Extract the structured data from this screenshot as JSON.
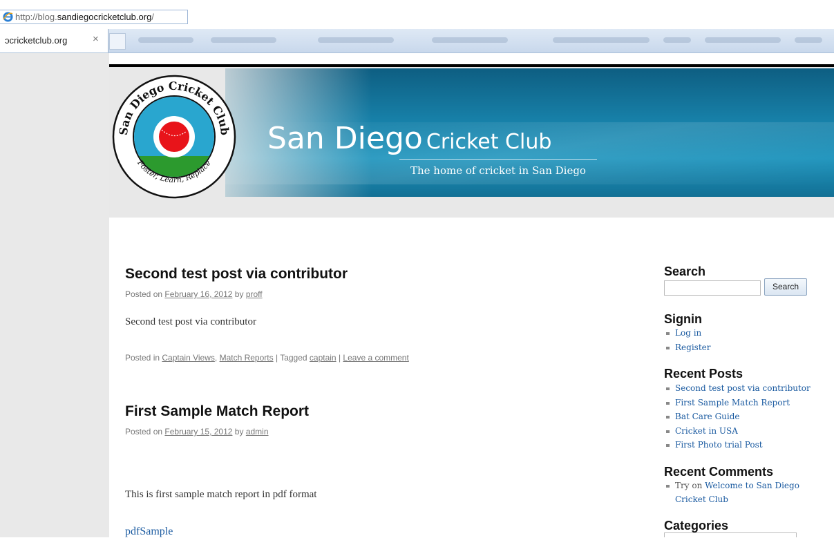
{
  "browser": {
    "url_prefix": "http://blog.",
    "url_domain": "sandiegocricketclub.org",
    "url_suffix": "/",
    "tab_title": "ɔcricketclub.org",
    "tab_close": "×"
  },
  "header": {
    "site_title_big": "San Diego",
    "site_title_small": "Cricket Club",
    "tagline": "The home of cricket in San Diego",
    "logo_ring_top": "San Diego Cricket Club",
    "logo_ring_bottom": "Foster, Learn, Replace"
  },
  "posts": [
    {
      "title": "Second test post via contributor",
      "meta_prefix": "Posted on",
      "date": "February 16, 2012",
      "by": "by",
      "author": "proff",
      "body": "Second test post via contributor",
      "posted_in": "Posted in",
      "category1": "Captain Views",
      "sep": ",",
      "category2": "Match Reports",
      "tagged": "| Tagged",
      "tag": "captain",
      "pipe": "|",
      "comment_link": "Leave a comment"
    },
    {
      "title": "First Sample Match Report",
      "meta_prefix": "Posted on",
      "date": "February 15, 2012",
      "by": "by",
      "author": "admin",
      "body": "This is first sample match report in pdf format",
      "attachment": "pdfSample"
    }
  ],
  "sidebar": {
    "search_title": "Search",
    "search_button": "Search",
    "search_value": "",
    "signin_title": "Signin",
    "signin_items": [
      "Log in",
      "Register"
    ],
    "recent_posts_title": "Recent Posts",
    "recent_posts": [
      "Second test post via contributor",
      "First Sample Match Report",
      "Bat Care Guide",
      "Cricket in USA",
      "First Photo trial Post"
    ],
    "recent_comments_title": "Recent Comments",
    "comment_author": "Try",
    "comment_on": "on",
    "comment_post_line1": "Welcome to San Diego",
    "comment_post_line2": "Cricket Club",
    "categories_title": "Categories"
  },
  "colors": {
    "link": "#1a5aa0",
    "banner_blue": "#1780a8",
    "logo_red": "#e8141a",
    "logo_green": "#2c9a2e"
  }
}
